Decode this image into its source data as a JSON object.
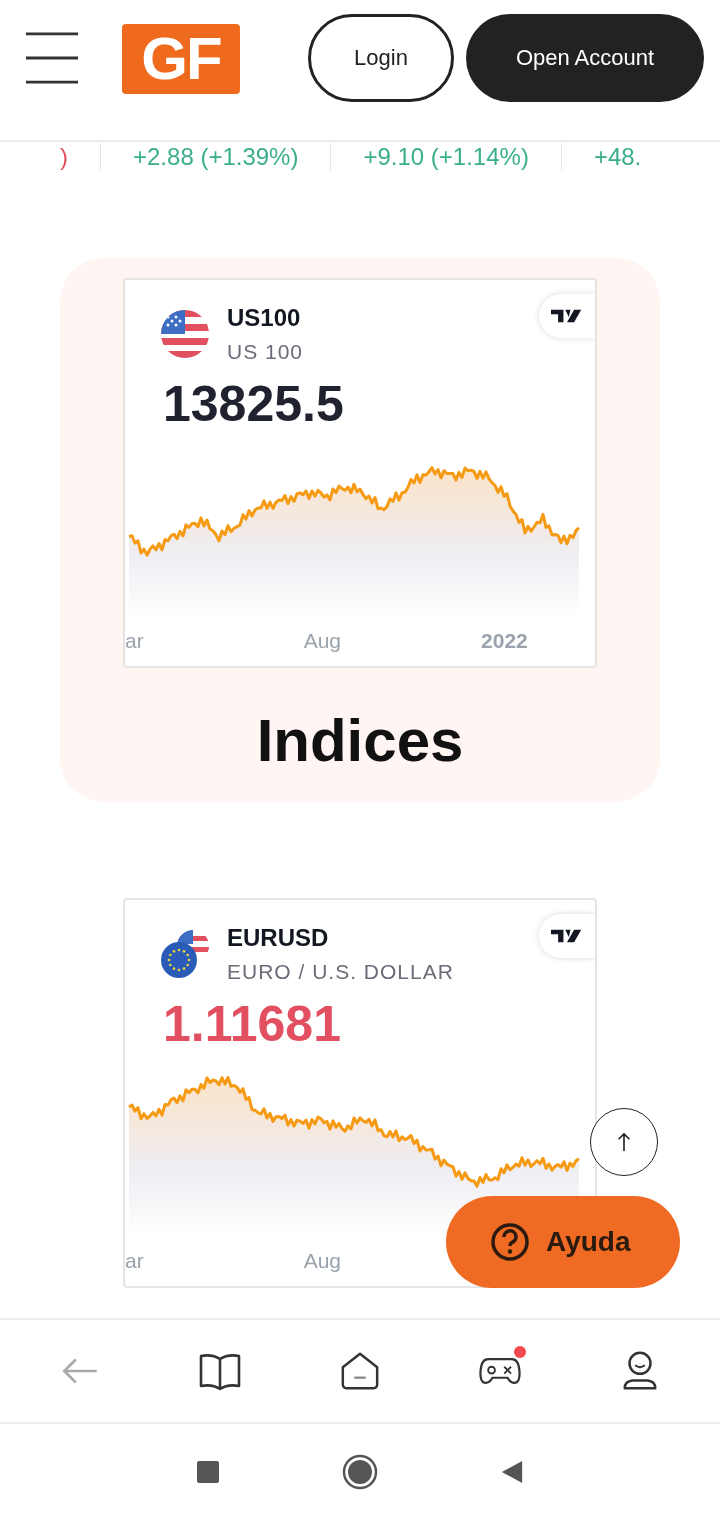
{
  "header": {
    "logo": "GF",
    "login": "Login",
    "open_account": "Open Account"
  },
  "ticker": [
    {
      "text": ")",
      "color": "#e0505f"
    },
    {
      "text": "+2.88 (+1.39%)",
      "color": "#3aae8c"
    },
    {
      "text": "+9.10 (+1.14%)",
      "color": "#3aae8c"
    },
    {
      "text": "+48.",
      "color": "#3aae8c"
    }
  ],
  "sections": [
    {
      "card": {
        "flag": {
          "kind": "us"
        },
        "symbol": "US100",
        "name": "US 100",
        "price": {
          "text": "13825.5",
          "color": "#202230"
        },
        "axis_labels": [
          {
            "text": "ar",
            "bold": false
          },
          {
            "text": "Aug",
            "bold": false
          },
          {
            "text": "2022",
            "bold": true
          }
        ]
      },
      "category": "Indices"
    },
    {
      "card": {
        "flag": {
          "kind": "eu-us"
        },
        "symbol": "EURUSD",
        "name": "EURO / U.S. DOLLAR",
        "price": {
          "text": "1.11681",
          "color": "#e14f60"
        },
        "axis_labels": [
          {
            "text": "ar",
            "bold": false
          },
          {
            "text": "Aug",
            "bold": false
          }
        ]
      }
    }
  ],
  "help": {
    "label": "Ayuda"
  },
  "bottom_nav": [
    {
      "kind": "back",
      "disabled": true,
      "badge": false
    },
    {
      "kind": "book",
      "disabled": false,
      "badge": false
    },
    {
      "kind": "home",
      "disabled": false,
      "badge": false
    },
    {
      "kind": "games",
      "disabled": false,
      "badge": true
    },
    {
      "kind": "profile",
      "disabled": false,
      "badge": false
    }
  ]
}
